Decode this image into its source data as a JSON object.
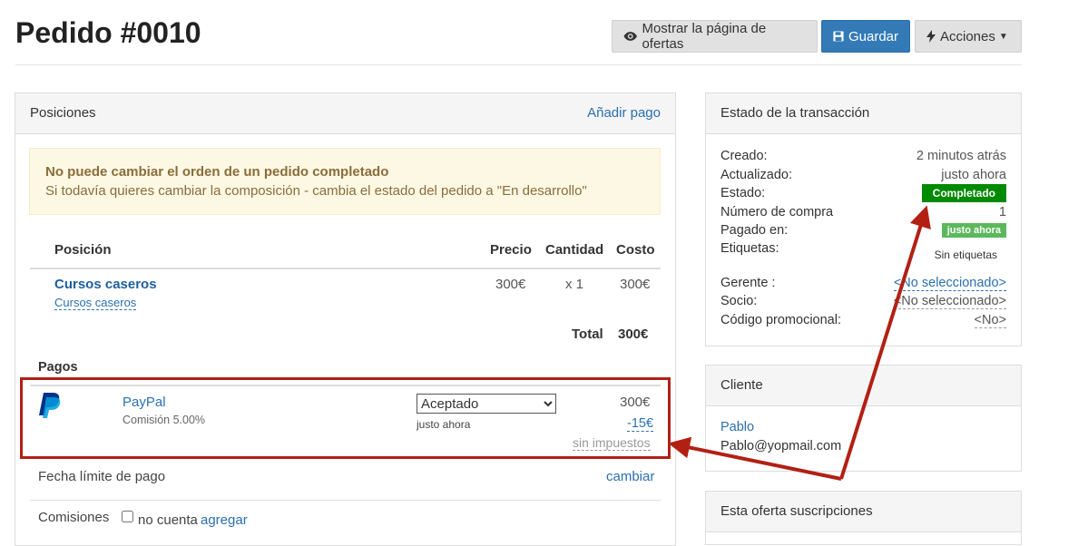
{
  "header": {
    "title": "Pedido #0010",
    "btn_show_offers": "Mostrar la página de ofertas",
    "btn_save": "Guardar",
    "btn_actions": "Acciones"
  },
  "positions_panel": {
    "title": "Posiciones",
    "add_payment": "Añadir pago",
    "alert_title": "No puede cambiar el orden de un pedido completado",
    "alert_text": "Si todavía quieres cambiar la composición - cambia el estado del pedido a \"En desarrollo\"",
    "columns": {
      "position": "Posición",
      "price": "Precio",
      "quantity": "Cantidad",
      "cost": "Costo"
    },
    "items": [
      {
        "name": "Cursos caseros",
        "sub": "Cursos caseros",
        "price": "300€",
        "quantity": "x 1",
        "cost": "300€"
      }
    ],
    "total_label": "Total",
    "total_value": "300€",
    "payments_title": "Pagos",
    "payment": {
      "method": "PayPal",
      "commission": "Comisión 5.00%",
      "status": "Aceptado",
      "status_options": [
        "Aceptado"
      ],
      "time": "justo ahora",
      "amount": "300€",
      "fee": "-15€",
      "tax": "sin impuestos"
    },
    "deadline_label": "Fecha límite de pago",
    "deadline_action": "cambiar",
    "commissions_label": "Comisiones",
    "commissions_checkbox": "no cuenta",
    "commissions_add": "agregar"
  },
  "transaction_panel": {
    "title": "Estado de la transacción",
    "created_label": "Creado:",
    "created_value": "2 minutos atrás",
    "updated_label": "Actualizado:",
    "updated_value": "justo ahora",
    "status_label": "Estado:",
    "status_value": "Completado",
    "purchase_number_label": "Número de compra",
    "purchase_number_value": "1",
    "paid_label": "Pagado en:",
    "paid_value": "justo ahora",
    "tags_label": "Etiquetas:",
    "tags_value": "Sin etiquetas",
    "manager_label": "Gerente :",
    "manager_value": "<No seleccionado>",
    "partner_label": "Socio:",
    "partner_value": "<No seleccionado>",
    "promo_label": "Código promocional:",
    "promo_value": "<No>"
  },
  "client_panel": {
    "title": "Cliente",
    "name": "Pablo",
    "email": "Pablo@yopmail.com"
  },
  "subs_panel": {
    "title": "Esta oferta suscripciones"
  },
  "colors": {
    "primary": "#337ab7",
    "link": "#2a6fb0",
    "status_completed": "#008a00",
    "paid_badge": "#5cb85c",
    "annotation_red": "#b22014",
    "paypal_dark": "#003087",
    "paypal_light": "#009cde"
  }
}
